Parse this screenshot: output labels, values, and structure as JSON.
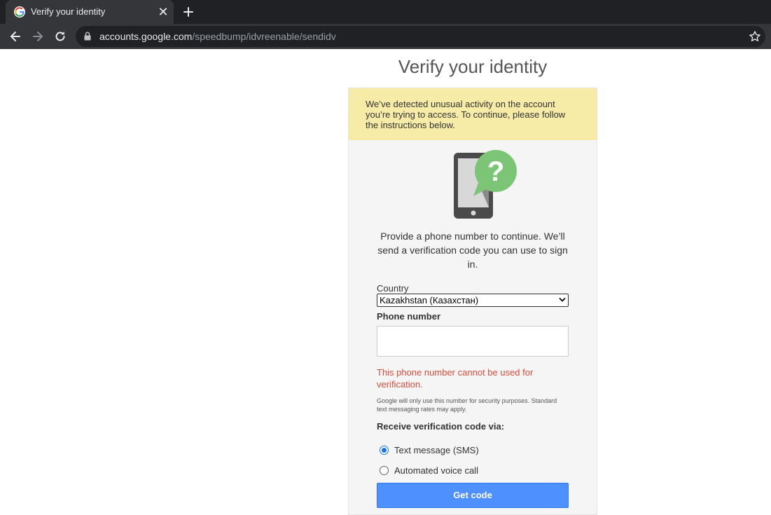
{
  "browser": {
    "tab_title": "Verify your identity",
    "close_glyph": "✕",
    "url_host": "accounts.google.com",
    "url_path": "/speedbump/idvreenable/sendidv"
  },
  "page": {
    "title": "Verify your identity",
    "notice": "We’ve detected unusual activity on the account you’re trying to access. To continue, please follow the instructions below.",
    "prompt": "Provide a phone number to continue. We’ll send a verification code you can use to sign in.",
    "country_label": "Country",
    "country_value": "Kazakhstan (Казахстан)",
    "phone_label": "Phone number",
    "phone_value": "",
    "error": "This phone number cannot be used for verification.",
    "fineprint": "Google will only use this number for security purposes. Standard text messaging rates may apply.",
    "via_label": "Receive verification code via:",
    "options": [
      {
        "label": "Text message (SMS)",
        "checked": true
      },
      {
        "label": "Automated voice call",
        "checked": false
      }
    ],
    "button_label": "Get code"
  },
  "colors": {
    "notice_bg": "#f6eba7",
    "error": "#dd4b39",
    "button": "#4d90fe",
    "radio_accent": "#1a73e8",
    "illustration_green": "#7cc576"
  },
  "icons": [
    "google-favicon-icon",
    "close-icon",
    "plus-icon",
    "back-icon",
    "forward-icon",
    "reload-icon",
    "lock-icon",
    "star-icon",
    "phone-question-icon",
    "chevron-down-icon"
  ]
}
